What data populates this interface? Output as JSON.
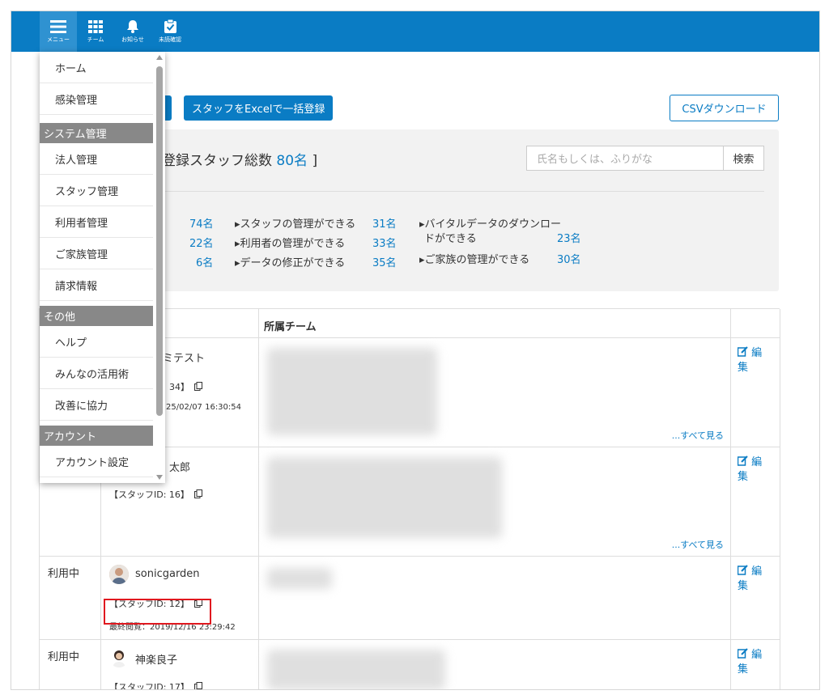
{
  "topbar": {
    "menu_label": "メニュー",
    "team_label": "チーム",
    "notice_label": "お知らせ",
    "unconfirmed_label": "未読確認"
  },
  "actions": {
    "bulk_register_partial": "録",
    "excel_register": "スタッフをExcelで一括登録",
    "csv_download": "CSVダウンロード"
  },
  "summary": {
    "title_prefix": "登録スタッフ総数 ",
    "total": "80名",
    "title_suffix": " ]",
    "search_placeholder": "氏名もしくは、ふりがな",
    "search_button": "検索",
    "left_counts": [
      "74名",
      "22名",
      "6名"
    ],
    "permissions": [
      {
        "label": "▸スタッフの管理ができる",
        "count": "31名"
      },
      {
        "label": "▸利用者の管理ができる",
        "count": "33名"
      },
      {
        "label": "▸データの修正ができる",
        "count": "35名"
      }
    ],
    "permissions2": [
      {
        "label_line1": "▸バイタルデータのダウンロー",
        "label_line2": "ドができる",
        "count": "23名"
      },
      {
        "label_line1": "▸ご家族の管理ができる",
        "label_line2": "",
        "count": "30名"
      }
    ]
  },
  "table": {
    "header_team": "所属チーム",
    "see_all": "...すべて見る",
    "edit_label": "編集",
    "rows": [
      {
        "status": "",
        "name": "ミテスト",
        "staff_id": "34】",
        "last_view": "25/02/07 16:30:54"
      },
      {
        "status": "",
        "name": "太郎",
        "staff_id": "【スタッフID: 16】",
        "last_view": ""
      },
      {
        "status": "利用中",
        "name": "sonicgarden",
        "staff_id": "【スタッフID: 12】",
        "last_view": "最終閲覧：2019/12/16 23:29:42"
      },
      {
        "status": "利用中",
        "name": "神楽良子",
        "staff_id": "【スタッフID: 17】",
        "last_view": ""
      }
    ]
  },
  "menu": {
    "items": [
      {
        "type": "item",
        "label": "ホーム"
      },
      {
        "type": "item",
        "label": "感染管理"
      },
      {
        "type": "section",
        "label": "システム管理"
      },
      {
        "type": "item",
        "label": "法人管理"
      },
      {
        "type": "item",
        "label": "スタッフ管理"
      },
      {
        "type": "item",
        "label": "利用者管理"
      },
      {
        "type": "item",
        "label": "ご家族管理"
      },
      {
        "type": "item",
        "label": "請求情報"
      },
      {
        "type": "section",
        "label": "その他"
      },
      {
        "type": "item",
        "label": "ヘルプ"
      },
      {
        "type": "item",
        "label": "みんなの活用術"
      },
      {
        "type": "item",
        "label": "改善に協力"
      },
      {
        "type": "section",
        "label": "アカウント"
      },
      {
        "type": "item",
        "label": "アカウント設定"
      }
    ]
  },
  "colors": {
    "brand": "#0a7cc4",
    "highlight": "#e0181f",
    "section_bg": "#888888"
  }
}
